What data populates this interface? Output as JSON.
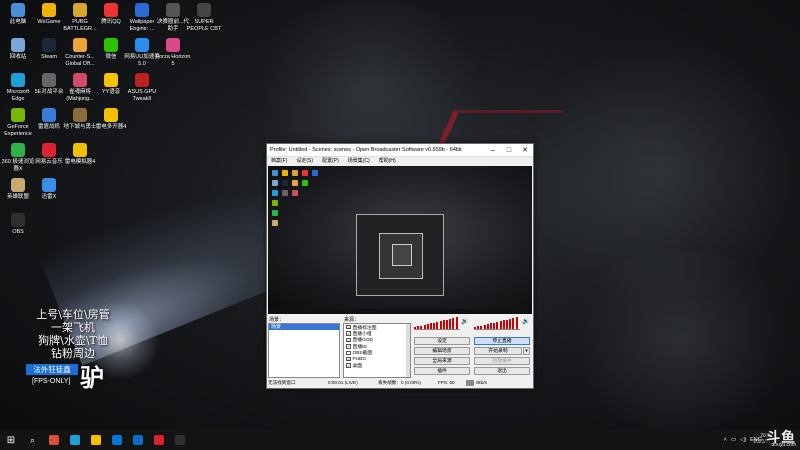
{
  "desktop": {
    "icons": [
      {
        "label": "此电脑",
        "icon": "computer-icon",
        "color": "#4a90d9"
      },
      {
        "label": "WeGame",
        "icon": "wegame-icon",
        "color": "#f0b400"
      },
      {
        "label": "PUBG BATTLEGR...",
        "icon": "pubg-icon",
        "color": "#d9a62e"
      },
      {
        "label": "腾讯QQ",
        "icon": "qq-icon",
        "color": "#e33"
      },
      {
        "label": "Wallpaper Engine: ...",
        "icon": "wallpaper-engine-icon",
        "color": "#2a6ad8"
      },
      {
        "label": "决赛圈前...代助手",
        "icon": "game-helper-icon",
        "color": "#555"
      },
      {
        "label": "SUPER PEOPLE CBT",
        "icon": "super-people-icon",
        "color": "#444"
      },
      {
        "label": "回收站",
        "icon": "recycle-bin-icon",
        "color": "#7aa6d8"
      },
      {
        "label": "Steam",
        "icon": "steam-icon",
        "color": "#1b2838"
      },
      {
        "label": "Counter-S... Global Off...",
        "icon": "csgo-icon",
        "color": "#e8a33b"
      },
      {
        "label": "微信",
        "icon": "wechat-icon",
        "color": "#2dc100"
      },
      {
        "label": "网易UU加速器5.0",
        "icon": "uu-accelerator-icon",
        "color": "#2a8df0"
      },
      {
        "label": "Forza Horizon 5",
        "icon": "forza-icon",
        "color": "#d84a8a"
      },
      {
        "label": "Microsoft Edge",
        "icon": "edge-icon",
        "color": "#1ea0d6"
      },
      {
        "label": "5E对战平台",
        "icon": "5e-platform-icon",
        "color": "#666"
      },
      {
        "label": "雀魂麻将 (Mahjong...",
        "icon": "mahjong-icon",
        "color": "#d04a6a"
      },
      {
        "label": "YY语音",
        "icon": "yy-voice-icon",
        "color": "#f5c400"
      },
      {
        "label": "ASUS GPU TweakII",
        "icon": "asus-gpu-icon",
        "color": "#b22"
      },
      {
        "label": "GeForce Experience",
        "icon": "geforce-icon",
        "color": "#76b900"
      },
      {
        "label": "雷霆战机",
        "icon": "thunder-game-icon",
        "color": "#3a7bd5"
      },
      {
        "label": "地下城与勇士",
        "icon": "dnf-icon",
        "color": "#8a6d3b"
      },
      {
        "label": "雷电多开器4",
        "icon": "ldplayer-multi-icon",
        "color": "#f2c200"
      },
      {
        "label": "360 极速浏览器X",
        "icon": "360-browser-icon",
        "color": "#2db34a"
      },
      {
        "label": "网易云音乐",
        "icon": "netease-music-icon",
        "color": "#d23"
      },
      {
        "label": "雷电模拟器4",
        "icon": "ldplayer-icon",
        "color": "#f2c200"
      },
      {
        "label": "英雄联盟",
        "icon": "lol-icon",
        "color": "#c8aa6e"
      },
      {
        "label": "迅雷X",
        "icon": "xunlei-icon",
        "color": "#3a8ee6"
      },
      {
        "label": "OBS",
        "icon": "obs-icon",
        "color": "#302e31"
      }
    ]
  },
  "overlay": {
    "lines": [
      "上号\\车位\\房管",
      "一架飞机",
      "狗牌\\水壶\\T恤",
      "钻粉周边"
    ],
    "tag": "法外狂徒鑫",
    "fps": "[FPS-ONLY]",
    "glyph": "驴"
  },
  "obs": {
    "title": "Profile: Untitled - Scenes: scenes - Open Broadcaster Software v0.659b - 64bit",
    "menu": [
      "档案(F)",
      "设定(S)",
      "配置(P)",
      "场景集(C)",
      "帮助(H)"
    ],
    "scenes_label": "场景：",
    "sources_label": "来源：",
    "scenes": [
      "场景"
    ],
    "sources": [
      {
        "name": "直播标注图",
        "checked": true
      },
      {
        "name": "直播小组",
        "checked": true
      },
      {
        "name": "直播GOD",
        "checked": true
      },
      {
        "name": "直播ID",
        "checked": true
      },
      {
        "name": "OBS截图",
        "checked": false
      },
      {
        "name": "PUBG",
        "checked": true
      },
      {
        "name": "桌面",
        "checked": true
      }
    ],
    "buttons": {
      "settings": "设定",
      "stop_stream": "停止直播",
      "edit_scene": "编辑场景",
      "start_record": "开始录制",
      "global_sources": "全局来源",
      "replay_buffer": "回放缓冲",
      "plugins": "插件",
      "exit": "退出"
    },
    "status": {
      "dropped": "丢失的帧数：0",
      "time": "0:00:01 (LIVE)",
      "frames": "丢失帧数：0 (0.00%)",
      "fps": "FPS: 60",
      "bitrate": "0kb/s",
      "left": "无法找到窗口"
    }
  },
  "taskbar": {
    "apps": [
      {
        "icon": "search-icon",
        "color": "#141414"
      },
      {
        "icon": "chrome-icon",
        "color": "#dd4b39"
      },
      {
        "icon": "edge-icon",
        "color": "#1ea0d6"
      },
      {
        "icon": "file-explorer-icon",
        "color": "#f2c200"
      },
      {
        "icon": "store-icon",
        "color": "#0078d7"
      },
      {
        "icon": "mail-icon",
        "color": "#0a6bc9"
      },
      {
        "icon": "netease-music-icon",
        "color": "#d23"
      },
      {
        "icon": "obs-icon",
        "color": "#302e31"
      }
    ],
    "tray_lang": "ENG",
    "clock_time": "20:5",
    "clock_date": "2021/..."
  },
  "watermark": {
    "brand": "斗鱼",
    "url": "douyu.com"
  }
}
